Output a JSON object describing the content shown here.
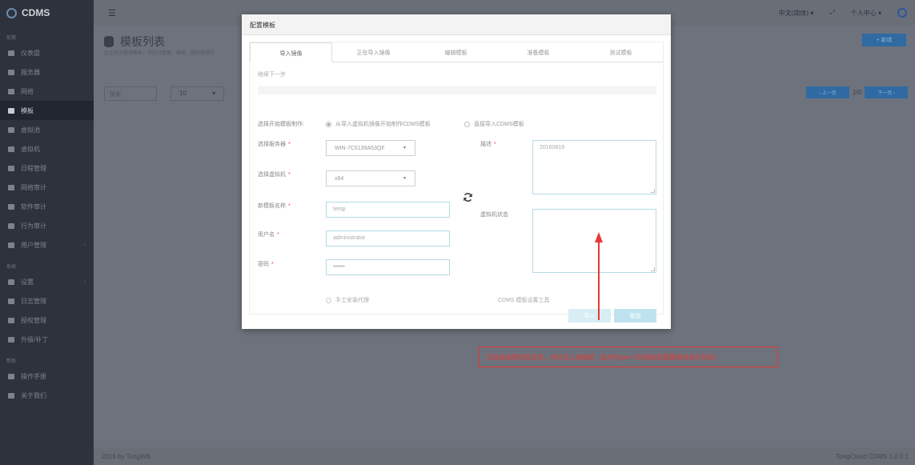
{
  "colors": {
    "accent": "#2f6aa3",
    "sidebar": "#2d323c",
    "annotation": "#e53a36",
    "input_border": "#b5dbe3"
  },
  "app": {
    "name": "CDMS"
  },
  "sidebar": {
    "section_1": "前期",
    "items_1": [
      {
        "label": "仪表盘",
        "icon": "home-icon"
      },
      {
        "label": "服务器",
        "icon": "server-icon"
      },
      {
        "label": "网络",
        "icon": "share-icon"
      },
      {
        "label": "模板",
        "icon": "template-icon",
        "active": true
      },
      {
        "label": "虚拟池",
        "icon": "pool-icon"
      },
      {
        "label": "虚拟机",
        "icon": "monitor-icon"
      },
      {
        "label": "日程管理",
        "icon": "calendar-icon"
      },
      {
        "label": "网络审计",
        "icon": "wrench-icon"
      },
      {
        "label": "软件审计",
        "icon": "cube-icon"
      },
      {
        "label": "行为审计",
        "icon": "card-icon"
      },
      {
        "label": "用户管理",
        "icon": "user-icon",
        "arrow": "‹"
      }
    ],
    "section_2": "系统",
    "items_2": [
      {
        "label": "设置",
        "icon": "gear-icon",
        "arrow": "‹"
      },
      {
        "label": "日志管理",
        "icon": "log-icon"
      },
      {
        "label": "授权管理",
        "icon": "key-icon"
      },
      {
        "label": "升级/补丁",
        "icon": "cloud-icon"
      }
    ],
    "section_3": "帮助",
    "items_3": [
      {
        "label": "操作手册",
        "icon": "question-icon"
      },
      {
        "label": "关于我们",
        "icon": "info-icon"
      }
    ]
  },
  "topbar": {
    "menu_icon": "☰",
    "language": "中文(简体) ▾",
    "fullscreen": "⤢",
    "user_center": "个人中心 ▾"
  },
  "page": {
    "title": "模板列表",
    "subtitle": "此处用于管理模板，可执行新建、编辑、删除等操作",
    "add_button": "+ 新增"
  },
  "list_controls": {
    "search_placeholder": "搜索",
    "page_size": "10",
    "page_size_caret": "▾",
    "prev": "‹ 上一页",
    "page_count": "1/0",
    "next": "下一页 ›"
  },
  "footer": {
    "left": "2016 by TongWB",
    "right": "TongCloud CDMS 1.0.0  1"
  },
  "modal": {
    "title": "配置模板",
    "tabs": [
      "导入镜像",
      "正在导入镜像",
      "编辑模板",
      "准备模板",
      "测试模板"
    ],
    "next_step": "继续下一步",
    "labels": {
      "start_mode": "选择开始模板制作:",
      "server": "选择服务器",
      "vm": "选择虚拟机",
      "template_name": "新模板名称",
      "username": "用户名",
      "password": "密码",
      "description": "描述",
      "vm_status": "虚拟机状态",
      "required": "*"
    },
    "radio_options": [
      "从导入虚拟机镜像开始制作CDMS模板",
      "直接导入CDMS模板"
    ],
    "values": {
      "server": "WIN-7C5139A53QF",
      "vm": "x64",
      "template_name": "temp",
      "username": "administrator",
      "password": "••••••",
      "description": "20160818",
      "vm_status": ""
    },
    "manual_agent": "手工安装代理",
    "tool_text": "CDMS 模板设置工具",
    "import_button": "导入",
    "cancel_button": "取消"
  },
  "annotation": {
    "text": "点选虚拟机状态信息，并点击上虚拟机（此时Hyper-V的虚拟机需要保持运行状态）"
  }
}
